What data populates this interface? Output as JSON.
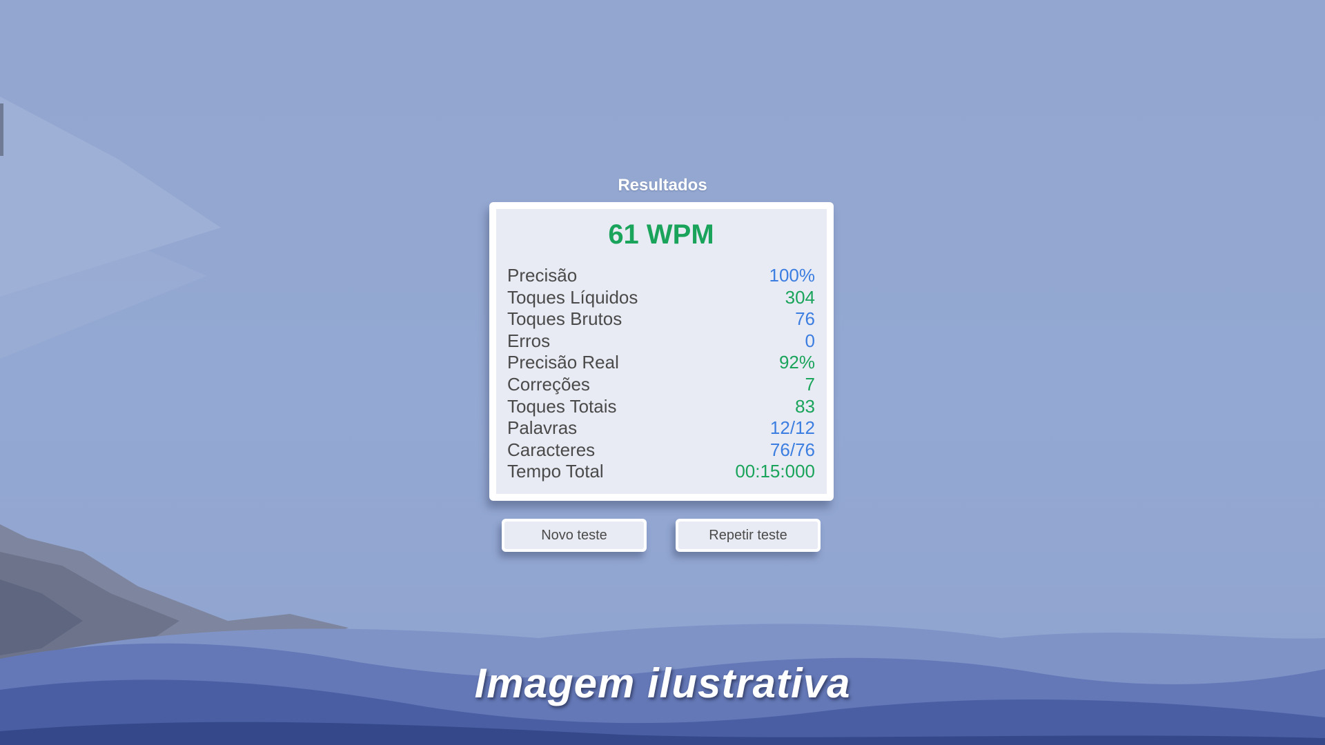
{
  "results": {
    "title": "Resultados",
    "wpm": "61 WPM",
    "stats": [
      {
        "label": "Precisão",
        "value": "100%",
        "color": "blue"
      },
      {
        "label": "Toques Líquidos",
        "value": "304",
        "color": "green"
      },
      {
        "label": "Toques Brutos",
        "value": "76",
        "color": "blue"
      },
      {
        "label": "Erros",
        "value": "0",
        "color": "blue"
      },
      {
        "label": "Precisão Real",
        "value": "92%",
        "color": "green"
      },
      {
        "label": "Correções",
        "value": "7",
        "color": "green"
      },
      {
        "label": "Toques Totais",
        "value": "83",
        "color": "green"
      },
      {
        "label": "Palavras",
        "value": "12/12",
        "color": "blue"
      },
      {
        "label": "Caracteres",
        "value": "76/76",
        "color": "blue"
      },
      {
        "label": "Tempo Total",
        "value": "00:15:000",
        "color": "green"
      }
    ]
  },
  "buttons": {
    "new_test": "Novo teste",
    "repeat_test": "Repetir teste"
  },
  "caption": "Imagem ilustrativa",
  "colors": {
    "accent_green": "#1aa45b",
    "accent_blue": "#3b7de0",
    "background": "#93a6cf",
    "label_text": "#4a4a4a"
  }
}
